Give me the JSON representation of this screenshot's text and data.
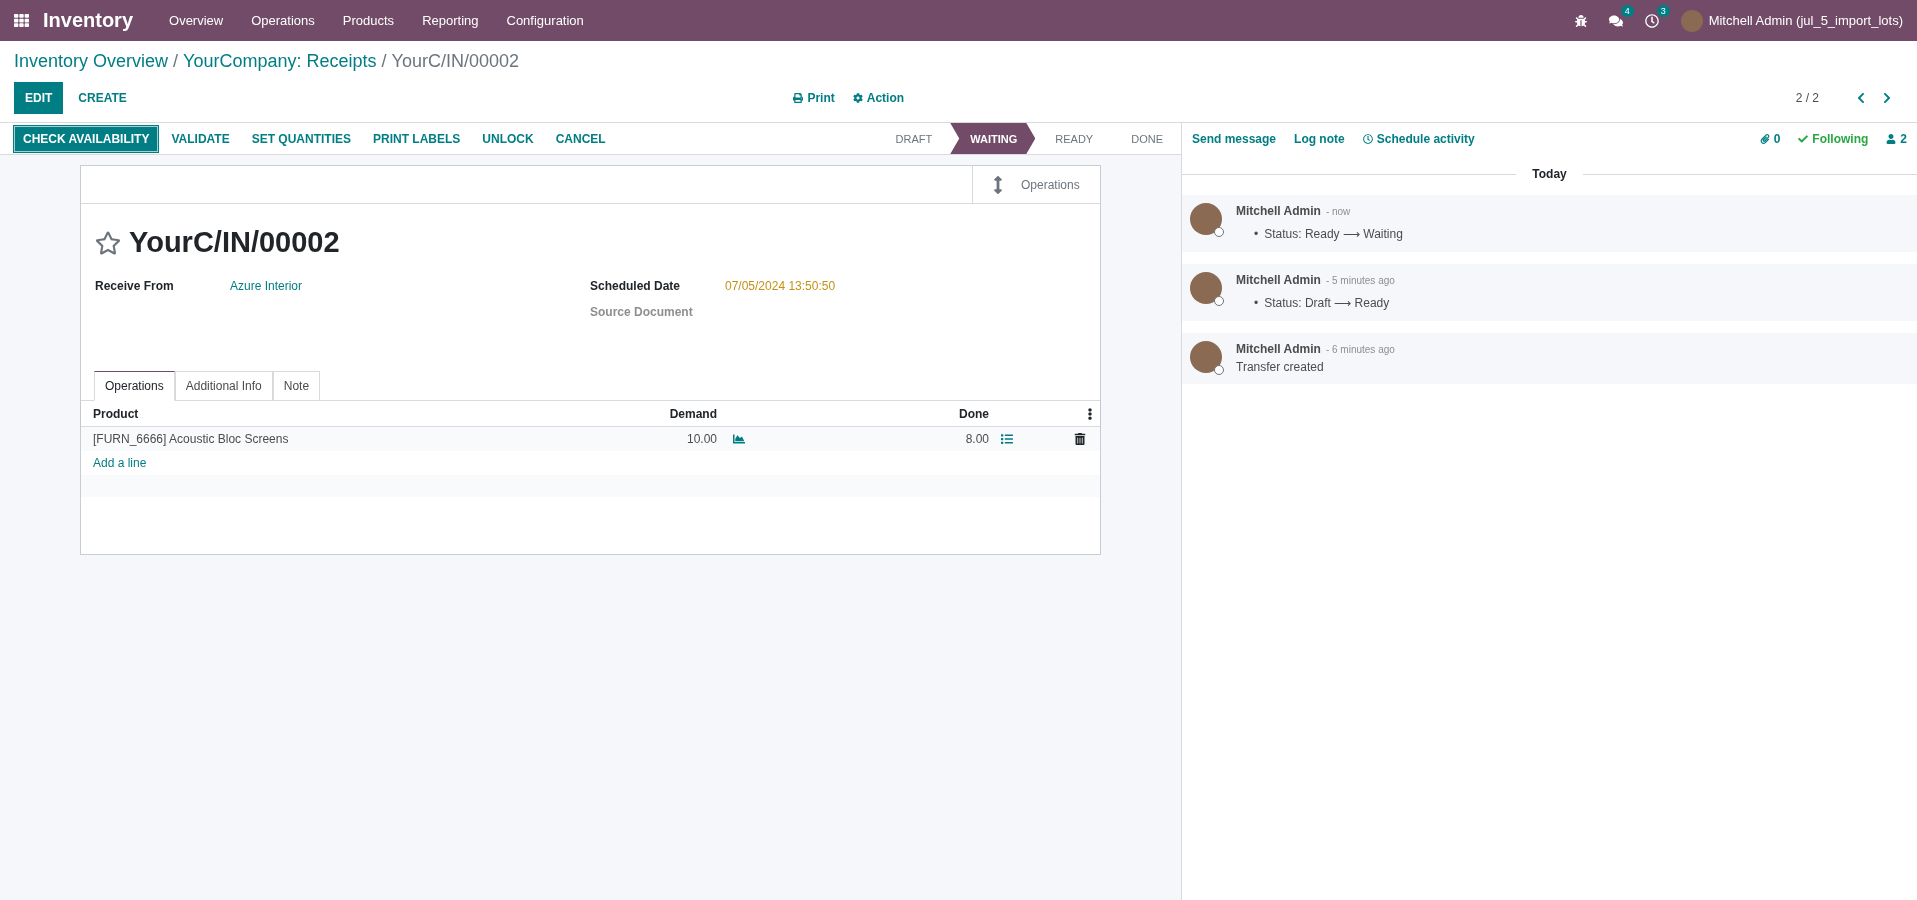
{
  "navbar": {
    "app_name": "Inventory",
    "menu": [
      "Overview",
      "Operations",
      "Products",
      "Reporting",
      "Configuration"
    ],
    "messages_badge": "4",
    "activities_badge": "3",
    "user": "Mitchell Admin (jul_5_import_lots)"
  },
  "breadcrumb": [
    {
      "label": "Inventory Overview",
      "link": true,
      "separator": "/"
    },
    {
      "label": "YourCompany: Receipts",
      "link": true,
      "separator": "/"
    },
    {
      "label": "YourC/IN/00002",
      "link": false
    }
  ],
  "buttons": [
    {
      "label": "EDIT",
      "primary": true
    },
    {
      "label": "CREATE",
      "primary": false
    }
  ],
  "actions": [
    {
      "label": "Print",
      "kind": "print"
    },
    {
      "label": "Action",
      "kind": "action"
    }
  ],
  "pager": "2 / 2",
  "action_buttons": [
    {
      "label": "CHECK AVAILABILITY",
      "primary": true
    },
    {
      "label": "VALIDATE",
      "primary": false
    },
    {
      "label": "SET QUANTITIES",
      "primary": false
    },
    {
      "label": "PRINT LABELS",
      "primary": false
    },
    {
      "label": "UNLOCK",
      "primary": false
    },
    {
      "label": "CANCEL",
      "primary": false
    }
  ],
  "stages": [
    {
      "label": "DRAFT",
      "selected": false
    },
    {
      "label": "WAITING",
      "selected": true
    },
    {
      "label": "READY",
      "selected": false
    },
    {
      "label": "DONE",
      "selected": false
    }
  ],
  "form": {
    "smart_button": "Operations",
    "starred": false,
    "title": "YourC/IN/00002",
    "left_fields": [
      {
        "label": "Receive From",
        "value": "Azure Interior",
        "kind": "link"
      }
    ],
    "right_fields": [
      {
        "label": "Scheduled Date",
        "value": "07/05/2024 13:50:50",
        "kind": "date"
      },
      {
        "label": "Source Document",
        "kind": "empty"
      }
    ],
    "tabs": [
      {
        "label": "Operations",
        "selected": true
      },
      {
        "label": "Additional Info",
        "selected": false
      },
      {
        "label": "Note",
        "selected": false
      }
    ],
    "table": {
      "columns": [
        "Product",
        "Demand",
        "Done"
      ],
      "rows": [
        {
          "product": "[FURN_6666] Acoustic Bloc Screens",
          "demand": "10.00",
          "done": "8.00"
        }
      ],
      "add_line": "Add a line"
    }
  },
  "chatter": {
    "buttons": [
      {
        "label": "Send message",
        "kind": "plain"
      },
      {
        "label": "Log note",
        "kind": "plain"
      },
      {
        "label": "Schedule activity",
        "kind": "activity"
      }
    ],
    "attachments": "0",
    "follow": "Following",
    "followers": "2",
    "date_separator": "Today",
    "messages": [
      {
        "author": "Mitchell Admin",
        "time": "- now",
        "kind": "tracking",
        "marker": "•",
        "text": "Status: Ready ⟶ Waiting"
      },
      {
        "author": "Mitchell Admin",
        "time": "- 5 minutes ago",
        "kind": "tracking",
        "marker": "•",
        "text": "Status: Draft ⟶ Ready"
      },
      {
        "author": "Mitchell Admin",
        "time": "- 6 minutes ago",
        "kind": "note",
        "text": "Transfer created"
      }
    ]
  }
}
